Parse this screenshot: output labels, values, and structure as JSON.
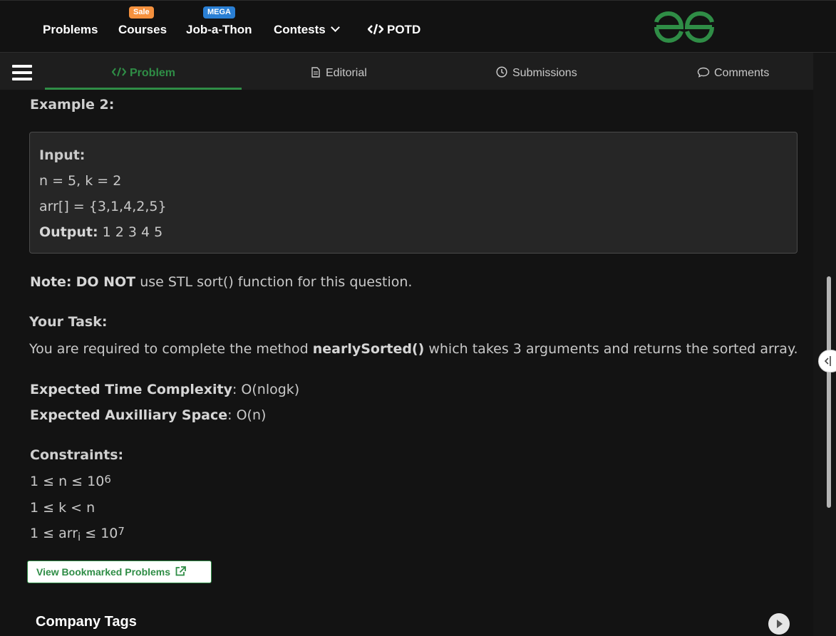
{
  "header": {
    "nav": [
      {
        "label": "Problems"
      },
      {
        "label": "Courses",
        "badge": "Sale",
        "badge_color": "#f5913e"
      },
      {
        "label": "Job-a-Thon",
        "badge": "MEGA",
        "badge_color": "#2a7fd4"
      },
      {
        "label": "Contests"
      },
      {
        "label": "POTD"
      }
    ],
    "logo": {
      "icon": "gfg-logo-icon",
      "color": "#2f8d46"
    }
  },
  "tabs": [
    {
      "label": "Problem",
      "icon": "code-icon",
      "active": true
    },
    {
      "label": "Editorial",
      "icon": "document-icon"
    },
    {
      "label": "Submissions",
      "icon": "clock-icon"
    },
    {
      "label": "Comments",
      "icon": "chat-icon"
    }
  ],
  "problem": {
    "example_heading": "Example 2:",
    "example": {
      "input_label": "Input:",
      "line1": "n = 5, k = 2",
      "line2": "arr[] = {3,1,4,2,5}",
      "output_label": "Output:",
      "output_value": "1 2 3 4 5"
    },
    "note_label": "Note:",
    "note_bold": "DO NOT",
    "note_text": "use STL sort() function for this question.",
    "task_heading": "Your Task:",
    "task_pre": "You are required to complete the method",
    "task_method": "nearlySorted()",
    "task_post": "which takes 3 arguments and returns the sorted array.",
    "time_label": "Expected Time Complexity",
    "time_value": ": O(nlogk)",
    "space_label": "Expected Auxilliary Space",
    "space_value": ": O(n)",
    "constraints_heading": "Constraints:",
    "c1_base": "1 ≤ n ≤ 10",
    "c1_sup": "6",
    "c2": "1 ≤ k < n",
    "c3_pre": "1 ≤ arr",
    "c3_sub": "i",
    "c3_mid": " ≤ 10",
    "c3_sup": "7"
  },
  "bookmark_button": "View Bookmarked Problems",
  "company_tags": "Company Tags",
  "colors": {
    "accent": "#2f8d46",
    "bg": "#131313",
    "panel": "#262626"
  }
}
